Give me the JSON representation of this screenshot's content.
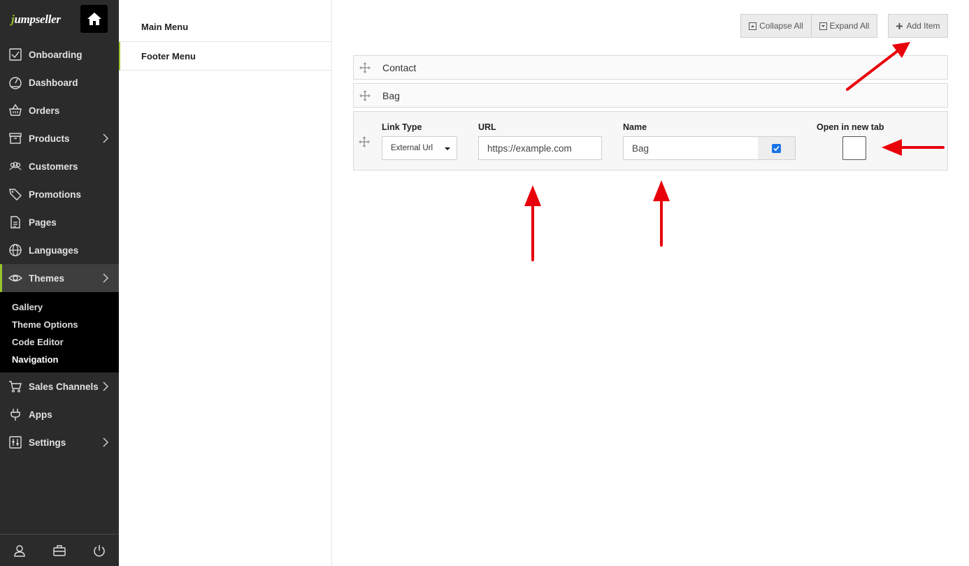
{
  "brand": {
    "logo_prefix": "j",
    "logo_rest": "umpseller"
  },
  "sidebar": {
    "items": [
      {
        "label": "Onboarding"
      },
      {
        "label": "Dashboard"
      },
      {
        "label": "Orders"
      },
      {
        "label": "Products"
      },
      {
        "label": "Customers"
      },
      {
        "label": "Promotions"
      },
      {
        "label": "Pages"
      },
      {
        "label": "Languages"
      },
      {
        "label": "Themes"
      },
      {
        "label": "Sales Channels"
      },
      {
        "label": "Apps"
      },
      {
        "label": "Settings"
      }
    ],
    "subitems": [
      {
        "label": "Gallery"
      },
      {
        "label": "Theme Options"
      },
      {
        "label": "Code Editor"
      },
      {
        "label": "Navigation"
      }
    ]
  },
  "menus": {
    "items": [
      {
        "label": "Main Menu"
      },
      {
        "label": "Footer Menu"
      }
    ]
  },
  "toolbar": {
    "collapse_all": "Collapse All",
    "expand_all": "Expand All",
    "add_item": "Add Item"
  },
  "rows": [
    {
      "label": "Contact"
    },
    {
      "label": "Bag"
    }
  ],
  "editor": {
    "link_type_label": "Link Type",
    "link_type_value": "External Url",
    "url_label": "URL",
    "url_value": "https://example.com",
    "name_label": "Name",
    "name_value": "Bag",
    "new_tab_label": "Open in new tab"
  },
  "colors": {
    "sidebar_bg": "#2b2b2b",
    "accent": "#9bc42c",
    "annotation": "#e8000b",
    "checkbox": "#1a73e8"
  }
}
